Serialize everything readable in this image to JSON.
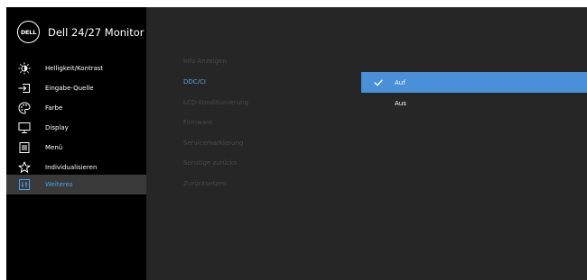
{
  "window": {
    "title": "Dell 24/27 Monitor",
    "logo_text": "DELL"
  },
  "sidebar": {
    "items": [
      {
        "label": "Helligkeit/Kontrast",
        "icon": "brightness-icon"
      },
      {
        "label": "Eingabe-Quelle",
        "icon": "input-source-icon"
      },
      {
        "label": "Farbe",
        "icon": "color-palette-icon"
      },
      {
        "label": "Display",
        "icon": "display-icon"
      },
      {
        "label": "Menü",
        "icon": "menu-icon"
      },
      {
        "label": "Individualisieren",
        "icon": "star-icon"
      },
      {
        "label": "Weiteres",
        "icon": "others-icon"
      }
    ],
    "selected": "Weiteres"
  },
  "submenu": {
    "items": [
      {
        "label": "Info Anzeigen"
      },
      {
        "label": "DDC/CI"
      },
      {
        "label": "LCD-Konditionierung"
      },
      {
        "label": "Firmware"
      },
      {
        "label": "Servicemarkierung"
      },
      {
        "label": "Sonstige zurücks"
      },
      {
        "label": "Zurücksetzen"
      }
    ],
    "active": "DDC/CI"
  },
  "options": {
    "items": [
      {
        "label": "Auf",
        "checked": true
      },
      {
        "label": "Aus",
        "checked": false
      }
    ]
  },
  "colors": {
    "sidebar_bg": "#000000",
    "panel_bg": "#262626",
    "accent": "#4a90d9",
    "active_text": "#5aa4e6",
    "disabled_text": "#4a4a4a"
  }
}
